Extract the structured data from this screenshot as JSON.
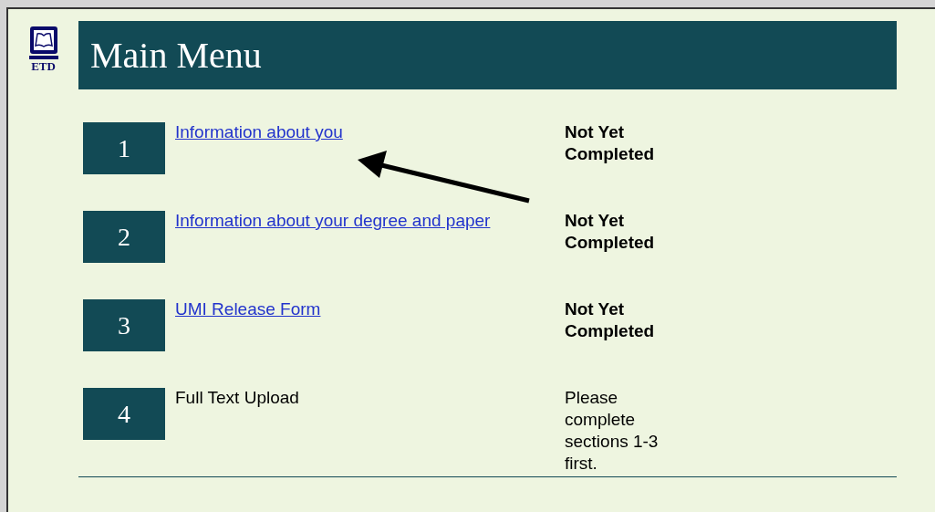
{
  "logo": {
    "text": "ETD"
  },
  "title": "Main Menu",
  "items": [
    {
      "number": "1",
      "label": "Information about you",
      "linked": true,
      "status": "Not Yet Completed",
      "emphasis": true
    },
    {
      "number": "2",
      "label": "Information about your degree and paper",
      "linked": true,
      "status": "Not Yet Completed",
      "emphasis": true
    },
    {
      "number": "3",
      "label": "UMI Release Form",
      "linked": true,
      "status": "Not Yet Completed",
      "emphasis": true
    },
    {
      "number": "4",
      "label": "Full Text Upload",
      "linked": false,
      "status": "Please complete sections 1-3 first.",
      "emphasis": false
    }
  ]
}
